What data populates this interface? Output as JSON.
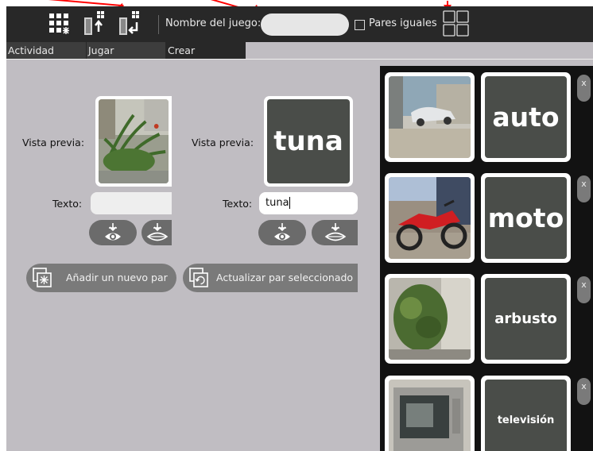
{
  "toolbar": {
    "game_name_label": "Nombre del juego:",
    "game_name_value": "",
    "equal_pairs_label": "Pares iguales",
    "equal_pairs_checked": false
  },
  "tabs": [
    "Actividad",
    "Jugar",
    "Crear"
  ],
  "editor": {
    "left": {
      "preview_label": "Vista previa:",
      "text_label": "Texto:",
      "text_value": ""
    },
    "right": {
      "preview_label": "Vista previa:",
      "preview_word": "tuna",
      "text_label": "Texto:",
      "text_value": "tuna"
    },
    "add_pair_label": "Añadir un nuevo par",
    "update_pair_label": "Actualizar par seleccionado"
  },
  "pairs": [
    {
      "word": "auto",
      "close": "x"
    },
    {
      "word": "moto",
      "close": "x"
    },
    {
      "word": "arbusto",
      "close": "x"
    },
    {
      "word": "televisión",
      "close": "x"
    }
  ],
  "colors": {
    "toolbar_bg": "#282828",
    "canvas_bg": "#c0bdc2",
    "panel_bg": "#121212",
    "word_card_bg": "#4a4d49",
    "annotation_arrow": "#ff0000"
  }
}
